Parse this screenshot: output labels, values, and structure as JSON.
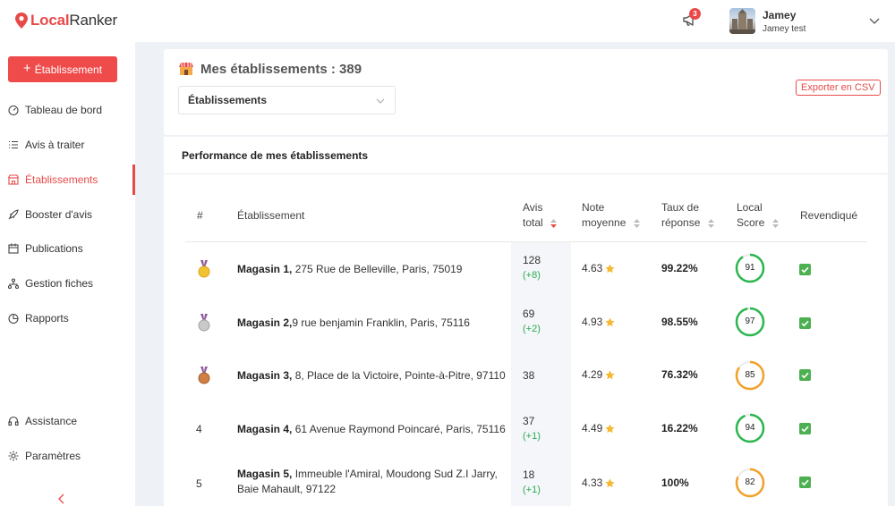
{
  "app": {
    "logo_prefix": "Local",
    "logo_suffix": "Ranker"
  },
  "header": {
    "notification_count": "3",
    "user_name": "Jamey",
    "user_sub": "Jamey test"
  },
  "sidebar": {
    "add_button": "Établissement",
    "items": [
      {
        "label": "Tableau de bord",
        "icon": "dashboard-icon"
      },
      {
        "label": "Avis à traiter",
        "icon": "list-icon"
      },
      {
        "label": "Établissements",
        "icon": "store-icon",
        "active": true
      },
      {
        "label": "Booster d'avis",
        "icon": "rocket-icon"
      },
      {
        "label": "Publications",
        "icon": "calendar-icon"
      },
      {
        "label": "Gestion fiches",
        "icon": "sitemap-icon"
      },
      {
        "label": "Rapports",
        "icon": "pie-icon"
      }
    ],
    "bottom_items": [
      {
        "label": "Assistance",
        "icon": "headset-icon"
      },
      {
        "label": "Paramètres",
        "icon": "gear-icon"
      }
    ]
  },
  "main": {
    "title": "Mes établissements : 389",
    "select_value": "Établissements",
    "export_button": "Exporter en CSV",
    "perf_title": "Performance de mes établissements",
    "columns": {
      "rank": "#",
      "estab": "Établissement",
      "avis_1": "Avis",
      "avis_2": "total",
      "note_1": "Note",
      "note_2": "moyenne",
      "taux_1": "Taux de",
      "taux_2": "réponse",
      "score_1": "Local",
      "score_2": "Score",
      "revendique": "Revendiqué"
    },
    "rows": [
      {
        "rank": "",
        "medal": "gold",
        "name": "Magasin 1,",
        "address": " 275 Rue de Belleville, Paris, 75019",
        "avis": "128",
        "delta": "(+8)",
        "note": "4.63",
        "taux": "99.22%",
        "score": "91",
        "score_color": "#2bb64f"
      },
      {
        "rank": "",
        "medal": "silver",
        "name": "Magasin 2,",
        "address": "9 rue benjamin Franklin, Paris, 75116",
        "avis": "69",
        "delta": "(+2)",
        "note": "4.93",
        "taux": "98.55%",
        "score": "97",
        "score_color": "#2bb64f"
      },
      {
        "rank": "",
        "medal": "bronze",
        "name": "Magasin 3,",
        "address": " 8, Place de la Victoire, Pointe-à-Pitre, 97110",
        "avis": "38",
        "delta": "",
        "note": "4.29",
        "taux": "76.32%",
        "score": "85",
        "score_color": "#f2a12b"
      },
      {
        "rank": "4",
        "medal": "",
        "name": "Magasin 4,",
        "address": " 61 Avenue Raymond Poincaré, Paris, 75116",
        "avis": "37",
        "delta": "(+1)",
        "note": "4.49",
        "taux": "16.22%",
        "score": "94",
        "score_color": "#2bb64f"
      },
      {
        "rank": "5",
        "medal": "",
        "name": "Magasin 5,",
        "address": " Immeuble l'Amiral, Moudong Sud Z.I Jarry, Baie Mahault, 97122",
        "avis": "18",
        "delta": "(+1)",
        "note": "4.33",
        "taux": "100%",
        "score": "82",
        "score_color": "#f2a12b"
      }
    ]
  },
  "colors": {
    "accent": "#e84a4a",
    "green": "#2bb64f",
    "orange": "#f2a12b",
    "star": "#f5b82e"
  }
}
